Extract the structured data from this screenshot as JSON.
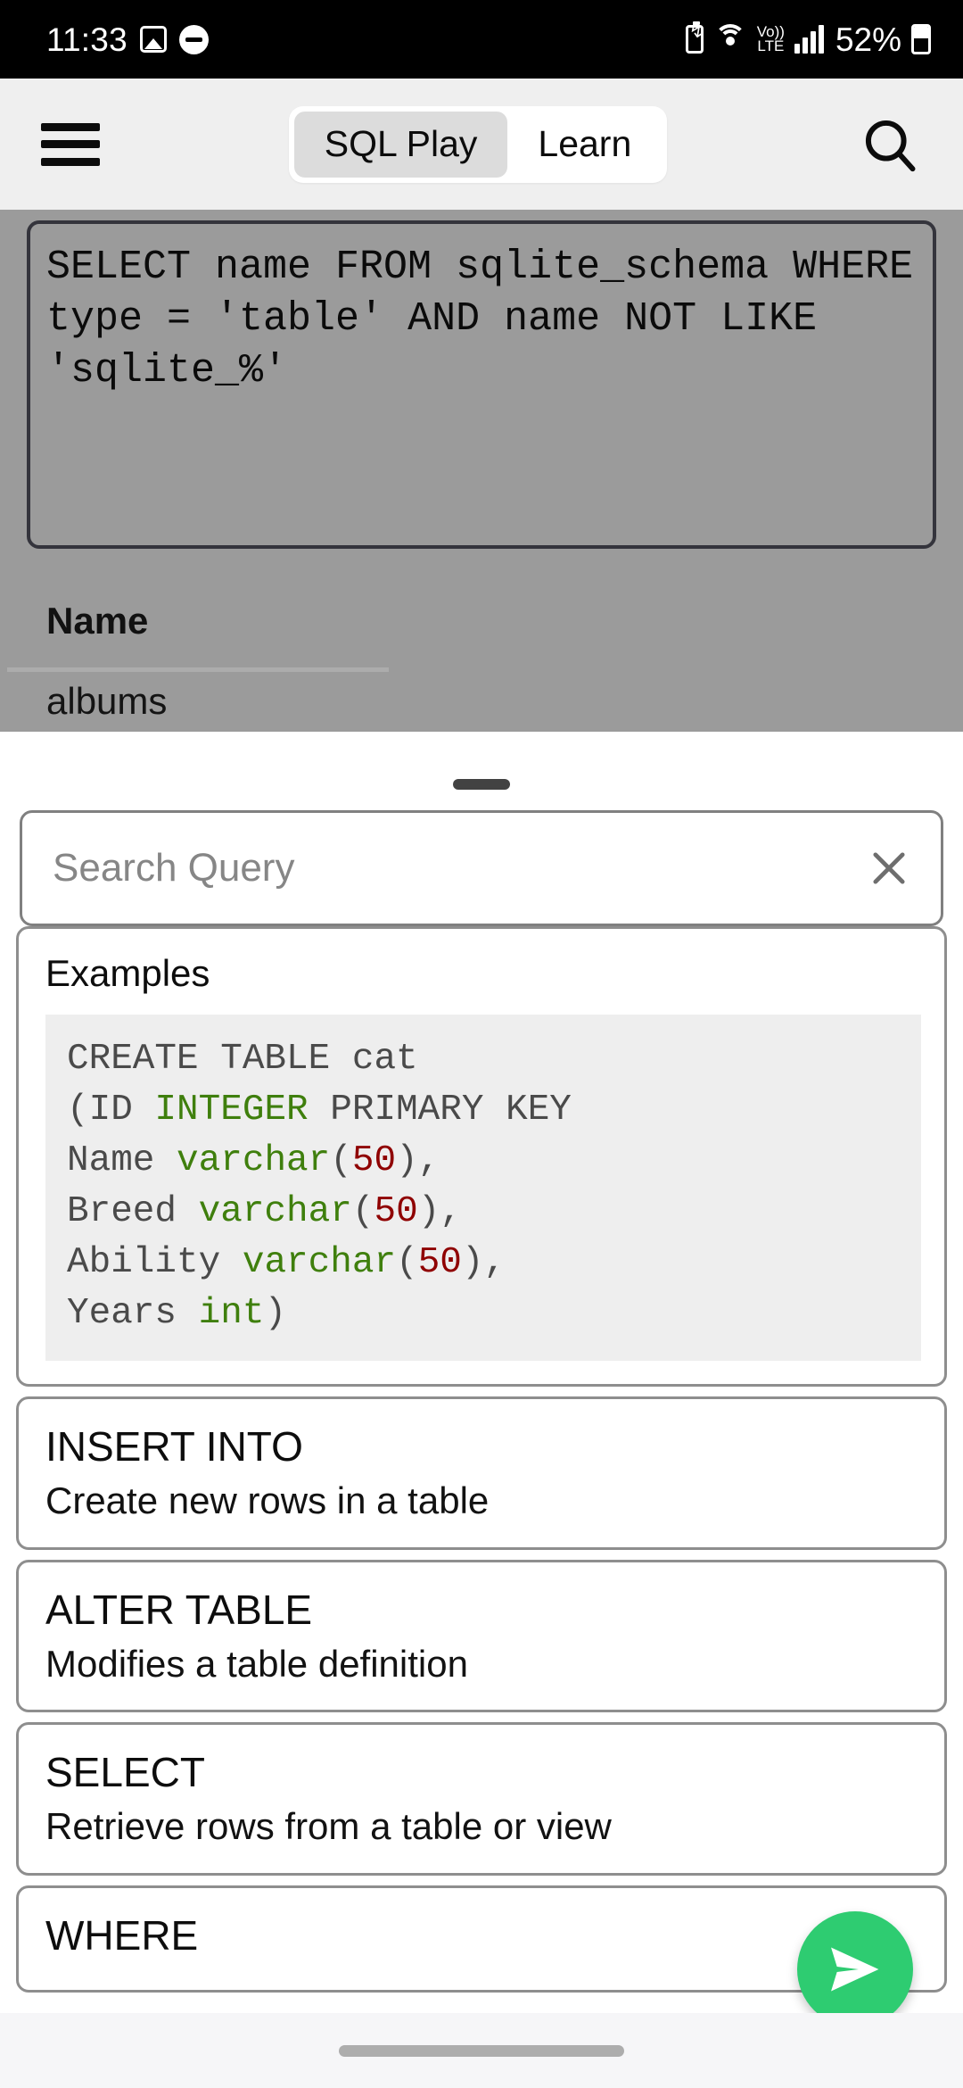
{
  "status_bar": {
    "time": "11:33",
    "battery_percent": "52%",
    "icons": [
      "photo-icon",
      "do-not-disturb-icon",
      "battery-saver-icon",
      "wifi-icon",
      "volte-icon",
      "signal-bars-icon",
      "battery-icon"
    ],
    "volte_top": "Vo))",
    "volte_bottom": "LTE"
  },
  "app_bar": {
    "menu_icon": "hamburger-menu-icon",
    "search_icon": "search-icon",
    "tabs": [
      {
        "label": "SQL Play",
        "selected": true
      },
      {
        "label": "Learn",
        "selected": false
      }
    ]
  },
  "background": {
    "query": "SELECT name FROM sqlite_schema WHERE type = 'table' AND name NOT LIKE 'sqlite_%'",
    "result_column_header": "Name",
    "result_first_row": "albums"
  },
  "sheet": {
    "search": {
      "placeholder": "Search Query",
      "value": "",
      "clear_icon": "close-x-icon"
    },
    "examples_label": "Examples",
    "example_code_lines": [
      {
        "segments": [
          {
            "t": "CREATE TABLE cat",
            "c": "plain"
          }
        ]
      },
      {
        "segments": [
          {
            "t": "(ID ",
            "c": "plain"
          },
          {
            "t": "INTEGER",
            "c": "type"
          },
          {
            "t": " PRIMARY KEY",
            "c": "plain"
          }
        ]
      },
      {
        "segments": [
          {
            "t": "Name ",
            "c": "plain"
          },
          {
            "t": "varchar",
            "c": "type"
          },
          {
            "t": "(",
            "c": "plain"
          },
          {
            "t": "50",
            "c": "num"
          },
          {
            "t": "),",
            "c": "plain"
          }
        ]
      },
      {
        "segments": [
          {
            "t": "Breed ",
            "c": "plain"
          },
          {
            "t": "varchar",
            "c": "type"
          },
          {
            "t": "(",
            "c": "plain"
          },
          {
            "t": "50",
            "c": "num"
          },
          {
            "t": "),",
            "c": "plain"
          }
        ]
      },
      {
        "segments": [
          {
            "t": "Ability ",
            "c": "plain"
          },
          {
            "t": "varchar",
            "c": "type"
          },
          {
            "t": "(",
            "c": "plain"
          },
          {
            "t": "50",
            "c": "num"
          },
          {
            "t": "),",
            "c": "plain"
          }
        ]
      },
      {
        "segments": [
          {
            "t": "Years ",
            "c": "plain"
          },
          {
            "t": "int",
            "c": "type"
          },
          {
            "t": ")",
            "c": "plain"
          }
        ]
      }
    ],
    "items": [
      {
        "title": "INSERT INTO",
        "subtitle": "Create new rows in a table"
      },
      {
        "title": "ALTER TABLE",
        "subtitle": "Modifies a table definition"
      },
      {
        "title": "SELECT",
        "subtitle": "Retrieve rows from a table or view"
      },
      {
        "title": "WHERE",
        "subtitle": ""
      }
    ]
  },
  "fab": {
    "icon": "send-icon",
    "color": "#2ecc71"
  },
  "colors": {
    "accent_green": "#2ecc71",
    "app_bar_bg": "#efefef",
    "scrim": "#9b9b9b",
    "code_bg": "#eeeeee",
    "syntax_type": "#3f7f0d",
    "syntax_number": "#8f0000"
  }
}
